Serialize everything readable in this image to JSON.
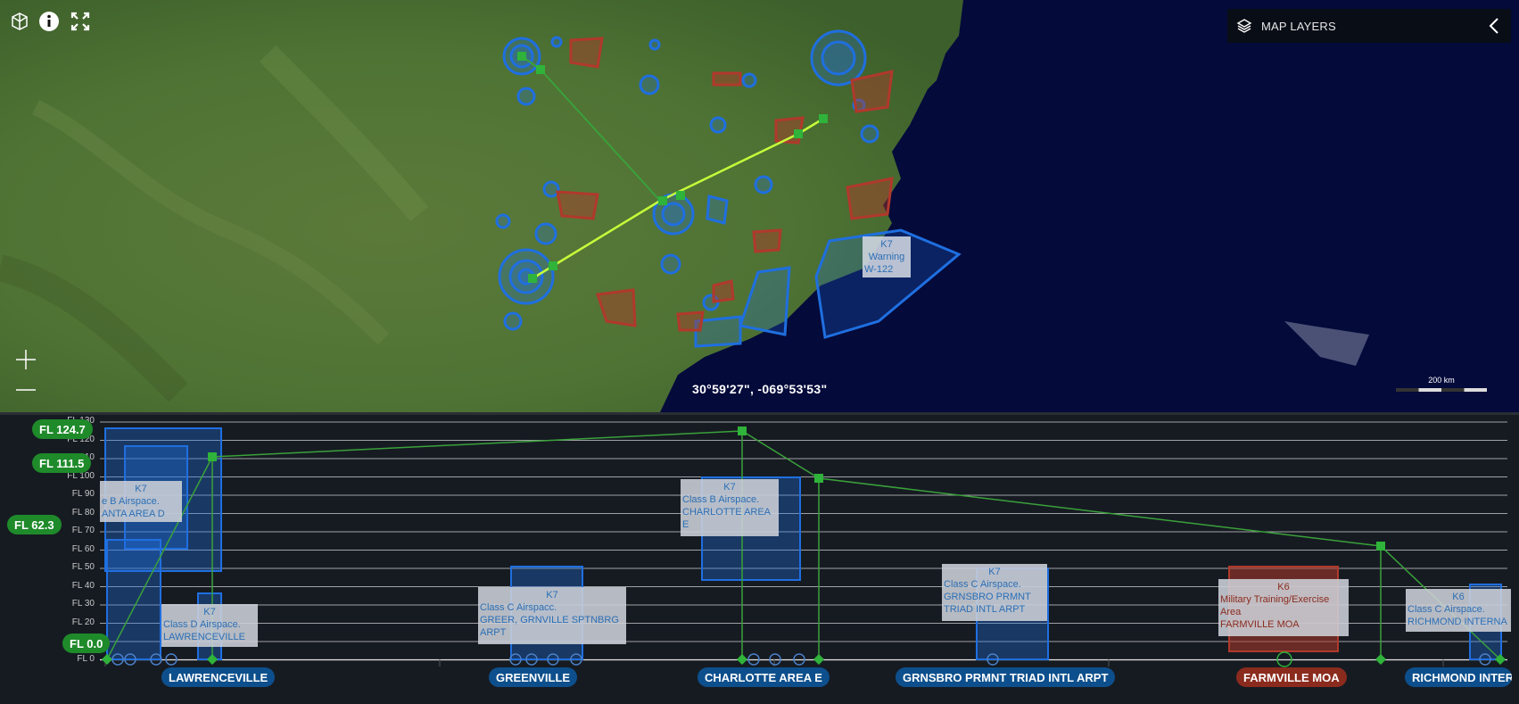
{
  "toolbar": {
    "cube_icon": "cube-icon",
    "info_icon": "info-icon",
    "fullscreen_icon": "fullscreen-icon"
  },
  "map_layers": {
    "label": "MAP LAYERS",
    "icon": "layers-icon",
    "collapse_icon": "chevron-left-icon"
  },
  "zoom": {
    "in": "zoom-in",
    "out": "zoom-out"
  },
  "coordinates": "30°59'27\", -069°53'53\"",
  "scale_label": "200 km",
  "map_labels": {
    "warning_code": "K7",
    "warning_type": "Warning",
    "warning_name": "W-122"
  },
  "profile": {
    "axis_ticks": [
      "FL 0",
      "FL 10",
      "FL 20",
      "FL 30",
      "FL 40",
      "FL 50",
      "FL 60",
      "FL 70",
      "FL 80",
      "FL 90",
      "FL 100",
      "FL 110",
      "FL 120",
      "FL 130"
    ],
    "flight_levels": [
      {
        "label": "FL 124.7"
      },
      {
        "label": "FL 111.5"
      },
      {
        "label": "FL 62.3"
      },
      {
        "label": "FL 0.0"
      }
    ],
    "airspace_boxes": [
      {
        "code": "K7",
        "type": "e B Airspace.",
        "name": "ANTA AREA D"
      },
      {
        "code": "K7",
        "type": "Class D Airspace.",
        "name": "LAWRENCEVILLE"
      },
      {
        "code": "K7",
        "type": "Class C Airspacc.",
        "name": "GREER, GRNVILLE SPTNBRG",
        "name2": "ARPT"
      },
      {
        "code": "K7",
        "type": "Class B Airspace.",
        "name": "CHARLOTTE AREA",
        "name2": "E"
      },
      {
        "code": "K7",
        "type": "Class C Airspace.",
        "name": "GRNSBRO PRMNT",
        "name2": "TRIAD INTL ARPT"
      },
      {
        "code": "K6",
        "type": "Military Training/Exercise",
        "name2": "Area",
        "name": "FARMVILLE MOA"
      },
      {
        "code": "K6",
        "type": "Class C Airspace.",
        "name": "RICHMOND INTERNA"
      }
    ],
    "waypoints": [
      {
        "label": "LAWRENCEVILLE",
        "color": "#0d4f8c"
      },
      {
        "label": "GREENVILLE",
        "color": "#0d4f8c"
      },
      {
        "label": "CHARLOTTE AREA E",
        "color": "#0d4f8c"
      },
      {
        "label": "GRNSBRO PRMNT TRIAD INTL ARPT",
        "color": "#0d4f8c"
      },
      {
        "label": "FARMVILLE MOA",
        "color": "#8a2b1e"
      },
      {
        "label": "RICHMOND INTERN",
        "color": "#0d4f8c"
      }
    ]
  },
  "colors": {
    "route_green": "#3aa13a",
    "route_highlight": "#c6ff3a",
    "airspace_blue": "#1f6fe0",
    "airspace_red": "#b0392b",
    "ocean": "#040a3a"
  }
}
